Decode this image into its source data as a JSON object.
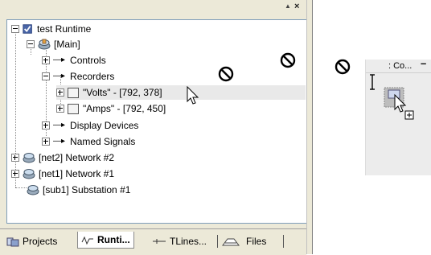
{
  "tree": {
    "root": {
      "label": "test Runtime"
    },
    "main": {
      "label": "[Main]"
    },
    "controls": {
      "label": "Controls"
    },
    "recorders": {
      "label": "Recorders"
    },
    "volts": {
      "label": "\"Volts\" - [792, 378]"
    },
    "amps": {
      "label": "\"Amps\" - [792, 450]"
    },
    "display_devices": {
      "label": "Display Devices"
    },
    "named_signals": {
      "label": "Named Signals"
    },
    "net2": {
      "label": "[net2] Network #2"
    },
    "net1": {
      "label": "[net1] Network #1"
    },
    "sub1": {
      "label": "[sub1] Substation #1"
    }
  },
  "tabs": {
    "projects": "Projects",
    "runtime": "Runti...",
    "tlines": "TLines...",
    "files": "Files"
  },
  "floating_window": {
    "title": ": Co...",
    "minimize": "–"
  },
  "header": {
    "pin_glyph": "▲",
    "close_glyph": "×"
  },
  "icons": {
    "root": "runtime-check-icon",
    "network": "network-icon",
    "folder_arrow": "arrow-icon",
    "recorder": "recorder-icon",
    "no_drop": "no-drop-icon",
    "text_cursor": "text-cursor-icon",
    "drag_copy": "drag-copy-cursor-icon"
  }
}
